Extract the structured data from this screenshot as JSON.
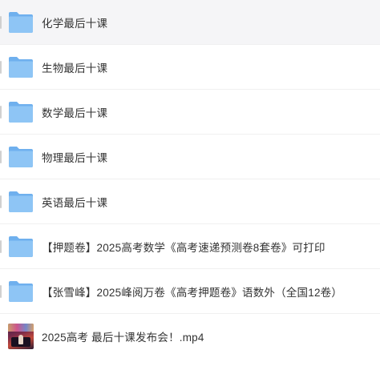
{
  "files": [
    {
      "name": "化学最后十课",
      "type": "folder",
      "icon": "folder-icon",
      "hovered": true
    },
    {
      "name": "生物最后十课",
      "type": "folder",
      "icon": "folder-icon"
    },
    {
      "name": "数学最后十课",
      "type": "folder",
      "icon": "folder-icon"
    },
    {
      "name": "物理最后十课",
      "type": "folder",
      "icon": "folder-icon"
    },
    {
      "name": "英语最后十课",
      "type": "folder",
      "icon": "folder-icon"
    },
    {
      "name": "【押题卷】2025高考数学《高考速递预测卷8套卷》可打印",
      "type": "folder",
      "icon": "folder-icon"
    },
    {
      "name": "【张雪峰】2025峰阅万卷《高考押题卷》语数外（全国12卷）",
      "type": "folder",
      "icon": "folder-icon"
    },
    {
      "name": "2025高考 最后十课发布会！.mp4",
      "type": "video",
      "icon": "video-thumbnail-icon"
    }
  ],
  "colors": {
    "folder_front": "#8ec5f5",
    "folder_back": "#6fb0ee",
    "row_hover": "#f5f5f7",
    "text": "#333333"
  }
}
